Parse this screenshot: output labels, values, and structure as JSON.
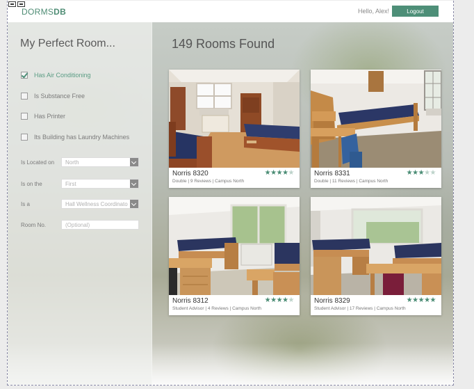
{
  "header": {
    "logo_light": "DORMS",
    "logo_bold": "DB",
    "greeting": "Hello, Alex!",
    "logout_label": "Logout"
  },
  "sidebar": {
    "title": "My Perfect Room...",
    "checkboxes": [
      {
        "label": "Has Air Conditioning",
        "checked": true
      },
      {
        "label": "Is Substance Free",
        "checked": false
      },
      {
        "label": "Has Printer",
        "checked": false
      },
      {
        "label": "Its Building has Laundry Machines",
        "checked": false
      }
    ],
    "fields": [
      {
        "label": "Is Located on",
        "value": "North"
      },
      {
        "label": "Is on the",
        "value": "First"
      },
      {
        "label": "Is a",
        "value": "Hall Wellness Coordinator"
      }
    ],
    "room_no": {
      "label": "Room No.",
      "placeholder": "(Optional)"
    }
  },
  "main": {
    "results_title": "149 Rooms Found",
    "rooms": [
      {
        "name": "Norris 8320",
        "meta": "Double | 9 Reviews | Campus North",
        "rating": 4
      },
      {
        "name": "Norris 8331",
        "meta": "Double | 11 Reviews | Campus North",
        "rating": 3
      },
      {
        "name": "Norris 8312",
        "meta": "Student Advisor | 4 Reviews | Campus North",
        "rating": 4
      },
      {
        "name": "Norris 8329",
        "meta": "Student Advisor | 17 Reviews | Campus North",
        "rating": 5
      }
    ]
  },
  "colors": {
    "accent": "#4e8f78",
    "star_on": "#4a8c74",
    "star_off": "#bcd2c9"
  },
  "icons": {
    "checkbox_checked": "checkmark-icon",
    "select_arrow": "chevron-down-icon",
    "star": "star-icon"
  }
}
